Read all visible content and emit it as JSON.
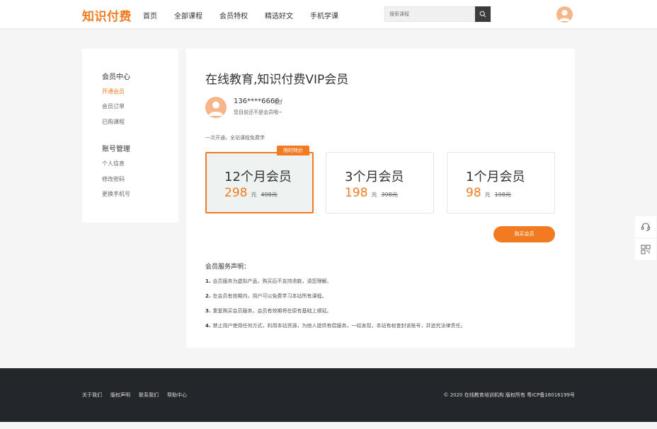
{
  "header": {
    "logo": "知识付费",
    "nav": [
      "首页",
      "全部课程",
      "会员特权",
      "精选好文",
      "手机学课"
    ],
    "search_placeholder": "搜索课程",
    "accent": "#f27b21"
  },
  "sidebar": {
    "group1": "会员中心",
    "group1_items": [
      "开通会员",
      "会员订单",
      "已购课程"
    ],
    "group2": "账号管理",
    "group2_items": [
      "个人信息",
      "修改密码",
      "更换手机号"
    ]
  },
  "main": {
    "title": "在线教育,知识付费VIP会员",
    "user_phone": "136****6666",
    "user_status": "您目前还不是会员哦~",
    "promo": "一次开通，全站课程免费学",
    "badge": "限时特价",
    "plans": [
      {
        "name": "12个月会员",
        "price": "298",
        "unit": "元",
        "original": "498元"
      },
      {
        "name": "3个月会员",
        "price": "198",
        "unit": "元",
        "original": "398元"
      },
      {
        "name": "1个月会员",
        "price": "98",
        "unit": "元",
        "original": "198元"
      }
    ],
    "buy_label": "购买会员",
    "notice_title": "会员服务声明：",
    "notices": [
      {
        "num": "1.",
        "text": "会员服务为虚拟产品，购买后不支持退款，请您理解。"
      },
      {
        "num": "2.",
        "text": "在会员有效期内，用户可以免费学习本站所有课程。"
      },
      {
        "num": "3.",
        "text": "重复购买会员服务，会员有效期将在原有基础上顺延。"
      },
      {
        "num": "4.",
        "text": "禁止用户使用任何方式，利用本站资源，为他人提供有偿服务，一经发现，本站有权查封该账号，并追究法律责任。"
      }
    ]
  },
  "footer": {
    "links": [
      "关于我们",
      "版权声明",
      "联系我们",
      "帮助中心"
    ],
    "copyright": "© 2020 在线教育培训机构 版权所有  粤ICP备16016199号"
  }
}
